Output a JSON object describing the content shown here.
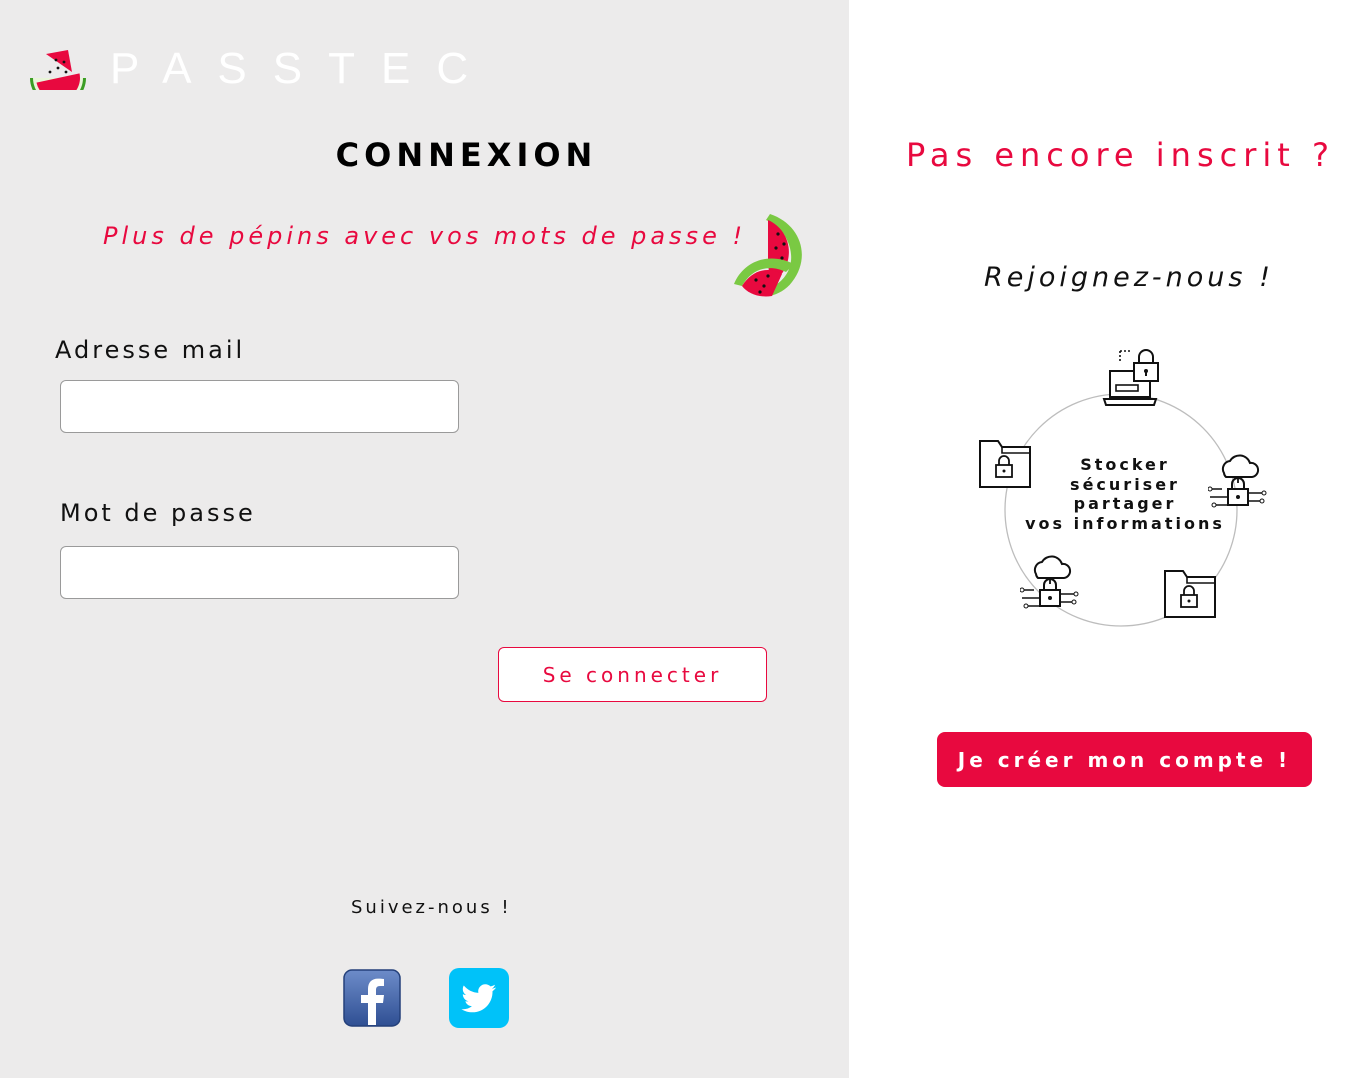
{
  "brand": {
    "name": "PASSTEC"
  },
  "login": {
    "title": "CONNEXION",
    "tagline": "Plus de pépins avec vos mots de passe !",
    "email_label": "Adresse mail",
    "email_value": "",
    "password_label": "Mot de passe",
    "password_value": "",
    "submit_label": "Se connecter"
  },
  "social": {
    "follow_label": "Suivez-nous !",
    "links": [
      {
        "icon": "facebook-icon"
      },
      {
        "icon": "twitter-icon"
      }
    ]
  },
  "signup": {
    "title": "Pas encore inscrit ?",
    "subtitle": "Rejoignez-nous !",
    "features": [
      "Stocker",
      "sécuriser",
      "partager",
      "vos informations"
    ],
    "feature_icons": [
      "laptop-lock-icon",
      "cloud-lock-icon",
      "folder-lock-icon",
      "cloud-lock-icon",
      "folder-lock-icon"
    ],
    "button_label": "Je créer mon compte !"
  },
  "colors": {
    "accent": "#e8093f",
    "left_bg": "#ecebeb",
    "right_bg": "#ffffff",
    "facebook": "#3b5998",
    "twitter": "#00c2f9"
  }
}
